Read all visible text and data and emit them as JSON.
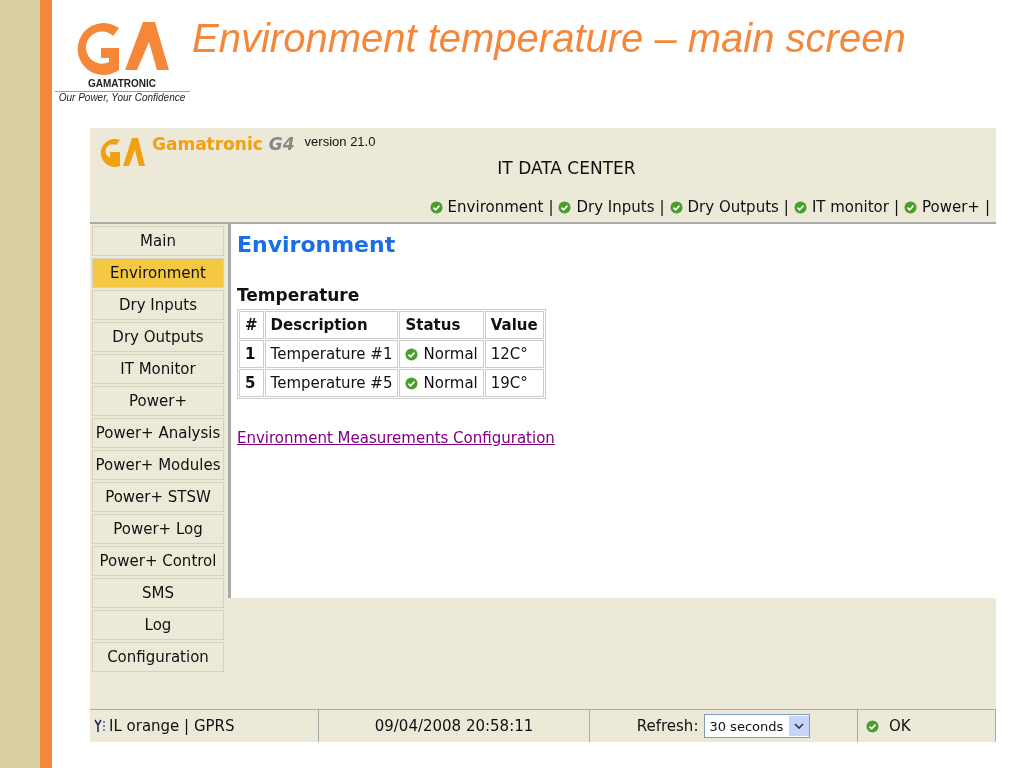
{
  "slide": {
    "title": "Environment temperature – main screen",
    "logo": {
      "brand": "GAMATRONIC",
      "tagline": "Our Power, Your Confidence"
    }
  },
  "app": {
    "brand": "Gamatronic",
    "product": "G4",
    "version": "version 21.0",
    "site": "IT DATA CENTER",
    "nav": [
      {
        "label": "Environment"
      },
      {
        "label": "Dry Inputs"
      },
      {
        "label": "Dry Outputs"
      },
      {
        "label": "IT monitor"
      },
      {
        "label": "Power+"
      }
    ],
    "nav_separator": "|",
    "sidebar": {
      "items": [
        {
          "label": "Main",
          "selected": false
        },
        {
          "label": "Environment",
          "selected": true
        },
        {
          "label": "Dry Inputs",
          "selected": false
        },
        {
          "label": "Dry Outputs",
          "selected": false
        },
        {
          "label": "IT Monitor",
          "selected": false
        },
        {
          "label": "Power+",
          "selected": false
        },
        {
          "label": "Power+ Analysis",
          "selected": false
        },
        {
          "label": "Power+ Modules",
          "selected": false
        },
        {
          "label": "Power+ STSW",
          "selected": false
        },
        {
          "label": "Power+ Log",
          "selected": false
        },
        {
          "label": "Power+ Control",
          "selected": false
        },
        {
          "label": "SMS",
          "selected": false
        },
        {
          "label": "Log",
          "selected": false
        },
        {
          "label": "Configuration",
          "selected": false
        }
      ]
    },
    "page_title": "Environment",
    "section_title": "Temperature",
    "table": {
      "columns": [
        "#",
        "Description",
        "Status",
        "Value"
      ],
      "rows": [
        {
          "number": "1",
          "description": "Temperature #1",
          "status": "Normal",
          "value": "12C°"
        },
        {
          "number": "5",
          "description": "Temperature #5",
          "status": "Normal",
          "value": "19C°"
        }
      ]
    },
    "config_link": "Environment Measurements Configuration",
    "status_bar": {
      "network": "IL orange | GPRS",
      "datetime": "09/04/2008 20:58:11",
      "refresh_label": "Refresh:",
      "refresh_value": "30 seconds",
      "state": "OK"
    }
  }
}
